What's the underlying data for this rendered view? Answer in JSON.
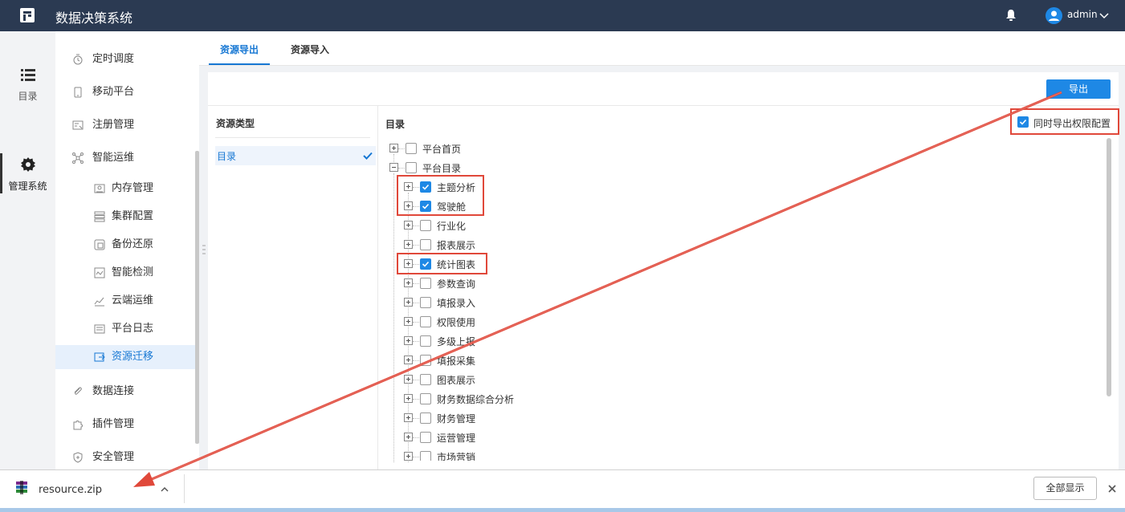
{
  "header": {
    "title": "数据决策系统",
    "user": "admin"
  },
  "rail": {
    "items": [
      {
        "label": "目录"
      },
      {
        "label": "管理系统"
      }
    ]
  },
  "menu": {
    "items": [
      {
        "label": "定时调度"
      },
      {
        "label": "移动平台"
      },
      {
        "label": "注册管理"
      },
      {
        "label": "智能运维"
      },
      {
        "label": "内存管理"
      },
      {
        "label": "集群配置"
      },
      {
        "label": "备份还原"
      },
      {
        "label": "智能检测"
      },
      {
        "label": "云端运维"
      },
      {
        "label": "平台日志"
      },
      {
        "label": "资源迁移"
      },
      {
        "label": "数据连接"
      },
      {
        "label": "插件管理"
      },
      {
        "label": "安全管理"
      }
    ]
  },
  "tabs": [
    {
      "label": "资源导出"
    },
    {
      "label": "资源导入"
    }
  ],
  "toolbar": {
    "export_label": "导出"
  },
  "resource_type": {
    "title": "资源类型",
    "items": [
      {
        "label": "目录"
      }
    ]
  },
  "directory": {
    "title": "目录",
    "export_permission_label": "同时导出权限配置",
    "tree": [
      {
        "label": "平台首页"
      },
      {
        "label": "平台目录"
      },
      {
        "label": "主题分析"
      },
      {
        "label": "驾驶舱"
      },
      {
        "label": "行业化"
      },
      {
        "label": "报表展示"
      },
      {
        "label": "统计图表"
      },
      {
        "label": "参数查询"
      },
      {
        "label": "填报录入"
      },
      {
        "label": "权限使用"
      },
      {
        "label": "多级上报"
      },
      {
        "label": "填报采集"
      },
      {
        "label": "图表展示"
      },
      {
        "label": "财务数据综合分析"
      },
      {
        "label": "财务管理"
      },
      {
        "label": "运营管理"
      },
      {
        "label": "市场营销"
      }
    ]
  },
  "download_bar": {
    "file_name": "resource.zip",
    "show_all_label": "全部显示"
  },
  "colors": {
    "header_bg": "#2b3a52",
    "accent": "#1e88e5",
    "highlight": "#e0483a"
  }
}
